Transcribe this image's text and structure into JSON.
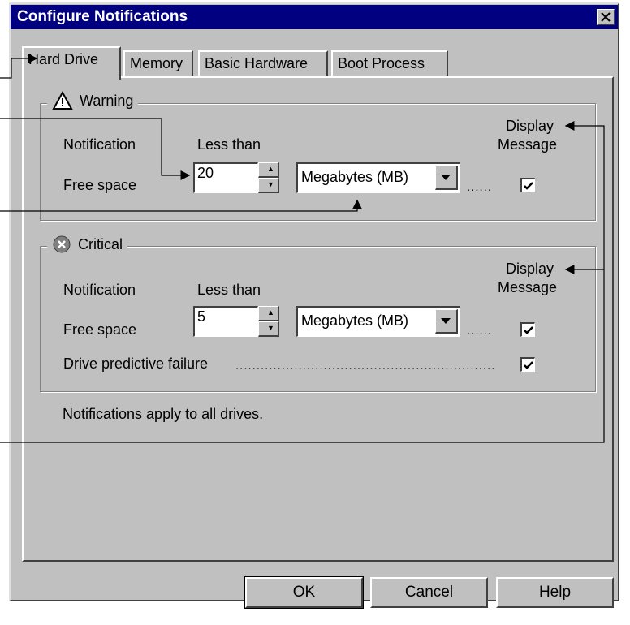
{
  "window": {
    "title": "Configure Notifications"
  },
  "tabs": [
    {
      "label": "Hard Drive",
      "active": true
    },
    {
      "label": "Memory",
      "active": false
    },
    {
      "label": "Basic Hardware",
      "active": false
    },
    {
      "label": "Boot Process",
      "active": false
    }
  ],
  "warning": {
    "title": "Warning",
    "col_notification": "Notification",
    "col_less_than": "Less than",
    "col_display": "Display",
    "col_message": "Message",
    "row_free_space": "Free space",
    "value": "20",
    "unit": "Megabytes (MB)",
    "leader": "......",
    "display_checked": true
  },
  "critical": {
    "title": "Critical",
    "col_notification": "Notification",
    "col_less_than": "Less than",
    "col_display": "Display",
    "col_message": "Message",
    "row_free_space": "Free space",
    "value": "5",
    "unit": "Megabytes (MB)",
    "leader": "......",
    "display_checked": true,
    "predictive_label": "Drive predictive failure",
    "predictive_leader": "...............................................................",
    "predictive_checked": true
  },
  "footer_note": "Notifications apply to all drives.",
  "buttons": {
    "ok": "OK",
    "cancel": "Cancel",
    "help": "Help"
  },
  "colors": {
    "titlebar": "#000080",
    "face": "#c0c0c0"
  },
  "icons": {
    "warning": "warning-triangle-icon",
    "critical": "critical-x-circle-icon",
    "close": "close-icon"
  }
}
